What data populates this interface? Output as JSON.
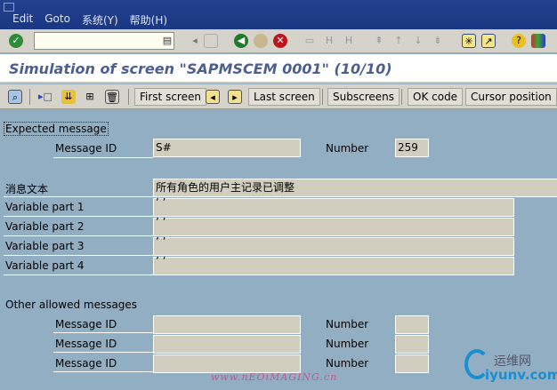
{
  "menu": [
    "Edit",
    "Goto",
    "系统(Y)",
    "帮助(H)"
  ],
  "title": "Simulation of screen \"SAPMSCEM 0001\" (10/10)",
  "app_toolbar": {
    "first_screen": "First screen",
    "last_screen": "Last screen",
    "subscreens": "Subscreens",
    "ok_code": "OK code",
    "cursor_position": "Cursor position"
  },
  "expected": {
    "heading": "Expected message",
    "msgid_label": "Message ID",
    "msgid": "S#",
    "number_label": "Number",
    "number": "259",
    "text_label": "消息文本",
    "text": "所有角色的用户主记录已调整",
    "vars": [
      {
        "label": "Variable part 1",
        "value": "’ ’"
      },
      {
        "label": "Variable part 2",
        "value": "’ ’"
      },
      {
        "label": "Variable part 3",
        "value": "’ ’"
      },
      {
        "label": "Variable part 4",
        "value": "’ ’"
      }
    ]
  },
  "other": {
    "heading": "Other allowed messages",
    "rows": [
      {
        "msgid_label": "Message ID",
        "number_label": "Number"
      },
      {
        "msgid_label": "Message ID",
        "number_label": "Number"
      },
      {
        "msgid_label": "Message ID",
        "number_label": "Number"
      }
    ]
  },
  "watermarks": [
    "www.nEOiMAGING.cn",
    "运维网",
    "iyunv.com"
  ]
}
